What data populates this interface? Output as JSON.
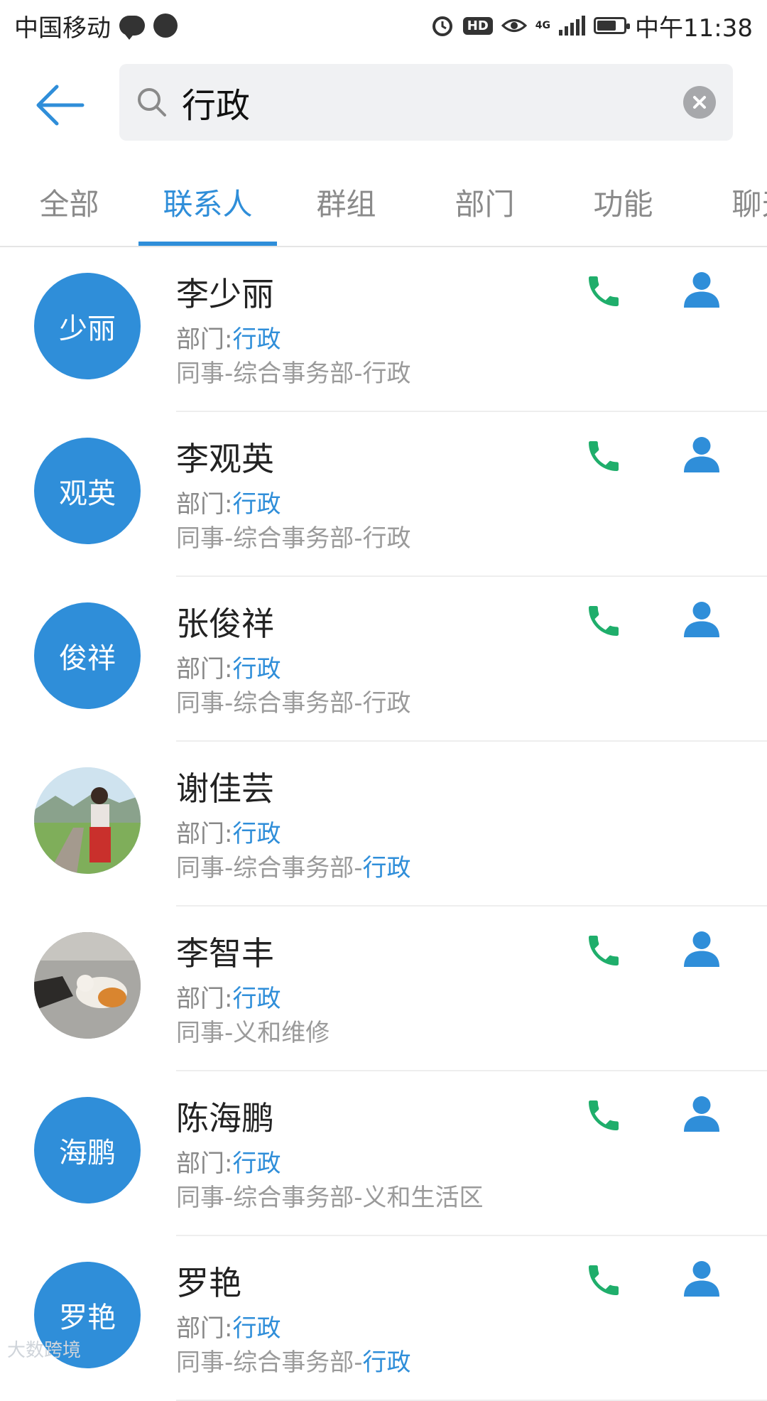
{
  "status_bar": {
    "carrier": "中国移动",
    "network": "4G",
    "time": "中午11:38",
    "hd": "HD"
  },
  "search": {
    "query": "行政",
    "placeholder": ""
  },
  "tabs": [
    {
      "label": "全部",
      "active": false
    },
    {
      "label": "联系人",
      "active": true
    },
    {
      "label": "群组",
      "active": false
    },
    {
      "label": "部门",
      "active": false
    },
    {
      "label": "功能",
      "active": false
    },
    {
      "label": "聊天",
      "active": false
    }
  ],
  "contacts": [
    {
      "name": "李少丽",
      "avatar_text": "少丽",
      "dept_label": "部门:",
      "dept_value": "行政",
      "path_prefix": "同事-综合事务部-",
      "path_highlight": "",
      "path_suffix": "行政"
    },
    {
      "name": "李观英",
      "avatar_text": "观英",
      "dept_label": "部门:",
      "dept_value": "行政",
      "path_prefix": "同事-综合事务部-",
      "path_highlight": "",
      "path_suffix": "行政"
    },
    {
      "name": "张俊祥",
      "avatar_text": "俊祥",
      "dept_label": "部门:",
      "dept_value": "行政",
      "path_prefix": "同事-综合事务部-",
      "path_highlight": "",
      "path_suffix": "行政"
    },
    {
      "name": "谢佳芸",
      "avatar_text": "",
      "dept_label": "部门:",
      "dept_value": "行政",
      "path_prefix": "同事-综合事务部-",
      "path_highlight": "行政",
      "path_suffix": ""
    },
    {
      "name": "李智丰",
      "avatar_text": "",
      "dept_label": "部门:",
      "dept_value": "行政",
      "path_prefix": "同事-义和维修",
      "path_highlight": "",
      "path_suffix": ""
    },
    {
      "name": "陈海鹏",
      "avatar_text": "海鹏",
      "dept_label": "部门:",
      "dept_value": "行政",
      "path_prefix": "同事-综合事务部-义和生活区",
      "path_highlight": "",
      "path_suffix": ""
    },
    {
      "name": "罗艳",
      "avatar_text": "罗艳",
      "dept_label": "部门:",
      "dept_value": "行政",
      "path_prefix": "同事-综合事务部-",
      "path_highlight": "行政",
      "path_suffix": ""
    }
  ],
  "colors": {
    "accent": "#2f8ed9",
    "call_green": "#1fae6b"
  },
  "icons": {
    "back": "arrow-left-icon",
    "search": "search-icon",
    "clear": "close-icon",
    "call": "phone-icon",
    "profile": "person-icon"
  },
  "watermark": "大数跨境"
}
